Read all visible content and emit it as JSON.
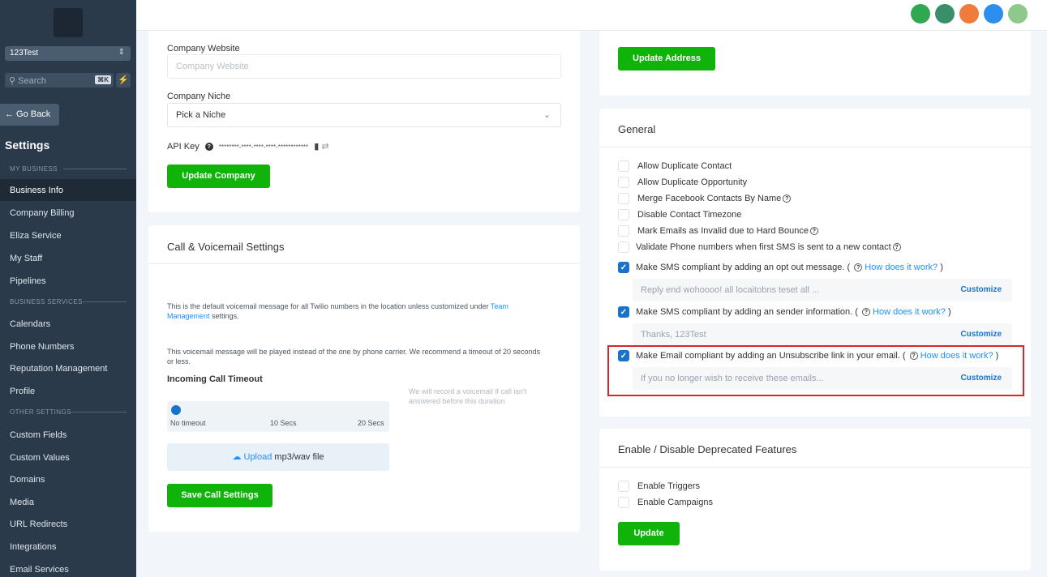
{
  "sidebar": {
    "location": "123Test",
    "search_placeholder": "Search",
    "search_shortcut": "⌘K",
    "go_back": "← Go Back",
    "title": "Settings",
    "section_my_business": "MY BUSINESS",
    "section_business_services": "BUSINESS SERVICES",
    "section_other_settings": "OTHER SETTINGS",
    "items": [
      {
        "label": "Business Info"
      },
      {
        "label": "Company Billing"
      },
      {
        "label": "Eliza Service"
      },
      {
        "label": "My Staff"
      },
      {
        "label": "Pipelines"
      },
      {
        "label": "Calendars"
      },
      {
        "label": "Phone Numbers"
      },
      {
        "label": "Reputation Management"
      },
      {
        "label": "Profile"
      },
      {
        "label": "Custom Fields"
      },
      {
        "label": "Custom Values"
      },
      {
        "label": "Domains"
      },
      {
        "label": "Media"
      },
      {
        "label": "URL Redirects"
      },
      {
        "label": "Integrations"
      },
      {
        "label": "Email Services"
      }
    ]
  },
  "company": {
    "website_label": "Company Website",
    "website_placeholder": "Company Website",
    "niche_label": "Company Niche",
    "niche_value": "Pick a Niche",
    "api_key_label": "API Key",
    "api_key_value": "********-****-****-****-************",
    "update_button": "Update Company"
  },
  "call": {
    "title": "Call & Voicemail Settings",
    "desc1_a": "This is the default voicemail message for all Twilio numbers in the location unless customized under ",
    "desc1_link": "Team Management",
    "desc1_b": " settings.",
    "desc2": "This voicemail message will be played instead of the one by phone carrier. We recommend a timeout of 20 seconds or less.",
    "timeout_label": "Incoming Call Timeout",
    "timeout_hint": "We will record a voicemail if call isn't answered before this duration",
    "slider_labels": [
      "No timeout",
      "10 Secs",
      "20 Secs"
    ],
    "slider_value_secs": 0,
    "upload_link": "Upload",
    "upload_text": " mp3/wav file",
    "save_button": "Save Call Settings"
  },
  "address": {
    "update_button": "Update Address"
  },
  "general": {
    "title": "General",
    "options": [
      {
        "label": "Allow Duplicate Contact",
        "checked": false,
        "help": false
      },
      {
        "label": "Allow Duplicate Opportunity",
        "checked": false,
        "help": false
      },
      {
        "label": "Merge Facebook Contacts By Name",
        "checked": false,
        "help": true
      },
      {
        "label": "Disable Contact Timezone",
        "checked": false,
        "help": false
      },
      {
        "label": "Mark Emails as Invalid due to Hard Bounce",
        "checked": false,
        "help": true
      },
      {
        "label": "Validate Phone numbers when first SMS is sent to a new contact",
        "checked": false,
        "help": true
      }
    ],
    "sms_optout": {
      "label": "Make SMS compliant by adding an opt out message. ( ",
      "link": "How does it work?",
      "close": " )",
      "message": "Reply  end wohoooo! all locaitobns teset all ...",
      "customize": "Customize",
      "checked": true
    },
    "sms_sender": {
      "label": "Make SMS compliant by adding an sender information. ( ",
      "link": "How does it work?",
      "close": " )",
      "message": "Thanks, 123Test",
      "customize": "Customize",
      "checked": true
    },
    "email_unsub": {
      "label": "Make Email compliant by adding an Unsubscribe link in your email. ( ",
      "link": "How does it work?",
      "close": " )",
      "message": "If you no longer wish to receive these emails...",
      "customize": "Customize",
      "checked": true
    }
  },
  "deprecated": {
    "title": "Enable / Disable Deprecated Features",
    "options": [
      {
        "label": "Enable Triggers",
        "checked": false
      },
      {
        "label": "Enable Campaigns",
        "checked": false
      }
    ],
    "update_button": "Update"
  },
  "colors": {
    "accent_green": "#0fb30a",
    "link_blue": "#1e90ff",
    "sidebar_bg": "#2b3a4a",
    "highlight_red": "#d9252f"
  }
}
